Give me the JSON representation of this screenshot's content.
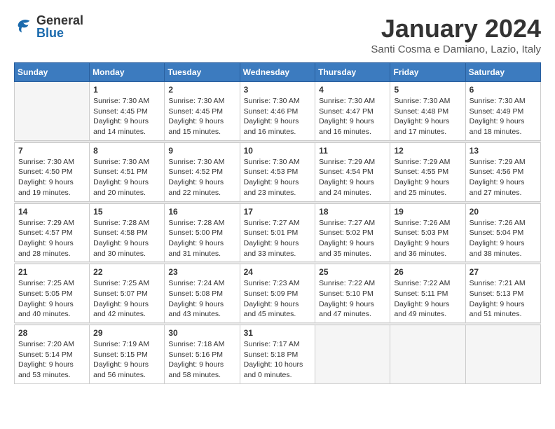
{
  "header": {
    "logo_general": "General",
    "logo_blue": "Blue",
    "month_title": "January 2024",
    "location": "Santi Cosma e Damiano, Lazio, Italy"
  },
  "calendar": {
    "days_of_week": [
      "Sunday",
      "Monday",
      "Tuesday",
      "Wednesday",
      "Thursday",
      "Friday",
      "Saturday"
    ],
    "weeks": [
      [
        {
          "num": "",
          "lines": []
        },
        {
          "num": "1",
          "lines": [
            "Sunrise: 7:30 AM",
            "Sunset: 4:45 PM",
            "Daylight: 9 hours",
            "and 14 minutes."
          ]
        },
        {
          "num": "2",
          "lines": [
            "Sunrise: 7:30 AM",
            "Sunset: 4:45 PM",
            "Daylight: 9 hours",
            "and 15 minutes."
          ]
        },
        {
          "num": "3",
          "lines": [
            "Sunrise: 7:30 AM",
            "Sunset: 4:46 PM",
            "Daylight: 9 hours",
            "and 16 minutes."
          ]
        },
        {
          "num": "4",
          "lines": [
            "Sunrise: 7:30 AM",
            "Sunset: 4:47 PM",
            "Daylight: 9 hours",
            "and 16 minutes."
          ]
        },
        {
          "num": "5",
          "lines": [
            "Sunrise: 7:30 AM",
            "Sunset: 4:48 PM",
            "Daylight: 9 hours",
            "and 17 minutes."
          ]
        },
        {
          "num": "6",
          "lines": [
            "Sunrise: 7:30 AM",
            "Sunset: 4:49 PM",
            "Daylight: 9 hours",
            "and 18 minutes."
          ]
        }
      ],
      [
        {
          "num": "7",
          "lines": [
            "Sunrise: 7:30 AM",
            "Sunset: 4:50 PM",
            "Daylight: 9 hours",
            "and 19 minutes."
          ]
        },
        {
          "num": "8",
          "lines": [
            "Sunrise: 7:30 AM",
            "Sunset: 4:51 PM",
            "Daylight: 9 hours",
            "and 20 minutes."
          ]
        },
        {
          "num": "9",
          "lines": [
            "Sunrise: 7:30 AM",
            "Sunset: 4:52 PM",
            "Daylight: 9 hours",
            "and 22 minutes."
          ]
        },
        {
          "num": "10",
          "lines": [
            "Sunrise: 7:30 AM",
            "Sunset: 4:53 PM",
            "Daylight: 9 hours",
            "and 23 minutes."
          ]
        },
        {
          "num": "11",
          "lines": [
            "Sunrise: 7:29 AM",
            "Sunset: 4:54 PM",
            "Daylight: 9 hours",
            "and 24 minutes."
          ]
        },
        {
          "num": "12",
          "lines": [
            "Sunrise: 7:29 AM",
            "Sunset: 4:55 PM",
            "Daylight: 9 hours",
            "and 25 minutes."
          ]
        },
        {
          "num": "13",
          "lines": [
            "Sunrise: 7:29 AM",
            "Sunset: 4:56 PM",
            "Daylight: 9 hours",
            "and 27 minutes."
          ]
        }
      ],
      [
        {
          "num": "14",
          "lines": [
            "Sunrise: 7:29 AM",
            "Sunset: 4:57 PM",
            "Daylight: 9 hours",
            "and 28 minutes."
          ]
        },
        {
          "num": "15",
          "lines": [
            "Sunrise: 7:28 AM",
            "Sunset: 4:58 PM",
            "Daylight: 9 hours",
            "and 30 minutes."
          ]
        },
        {
          "num": "16",
          "lines": [
            "Sunrise: 7:28 AM",
            "Sunset: 5:00 PM",
            "Daylight: 9 hours",
            "and 31 minutes."
          ]
        },
        {
          "num": "17",
          "lines": [
            "Sunrise: 7:27 AM",
            "Sunset: 5:01 PM",
            "Daylight: 9 hours",
            "and 33 minutes."
          ]
        },
        {
          "num": "18",
          "lines": [
            "Sunrise: 7:27 AM",
            "Sunset: 5:02 PM",
            "Daylight: 9 hours",
            "and 35 minutes."
          ]
        },
        {
          "num": "19",
          "lines": [
            "Sunrise: 7:26 AM",
            "Sunset: 5:03 PM",
            "Daylight: 9 hours",
            "and 36 minutes."
          ]
        },
        {
          "num": "20",
          "lines": [
            "Sunrise: 7:26 AM",
            "Sunset: 5:04 PM",
            "Daylight: 9 hours",
            "and 38 minutes."
          ]
        }
      ],
      [
        {
          "num": "21",
          "lines": [
            "Sunrise: 7:25 AM",
            "Sunset: 5:05 PM",
            "Daylight: 9 hours",
            "and 40 minutes."
          ]
        },
        {
          "num": "22",
          "lines": [
            "Sunrise: 7:25 AM",
            "Sunset: 5:07 PM",
            "Daylight: 9 hours",
            "and 42 minutes."
          ]
        },
        {
          "num": "23",
          "lines": [
            "Sunrise: 7:24 AM",
            "Sunset: 5:08 PM",
            "Daylight: 9 hours",
            "and 43 minutes."
          ]
        },
        {
          "num": "24",
          "lines": [
            "Sunrise: 7:23 AM",
            "Sunset: 5:09 PM",
            "Daylight: 9 hours",
            "and 45 minutes."
          ]
        },
        {
          "num": "25",
          "lines": [
            "Sunrise: 7:22 AM",
            "Sunset: 5:10 PM",
            "Daylight: 9 hours",
            "and 47 minutes."
          ]
        },
        {
          "num": "26",
          "lines": [
            "Sunrise: 7:22 AM",
            "Sunset: 5:11 PM",
            "Daylight: 9 hours",
            "and 49 minutes."
          ]
        },
        {
          "num": "27",
          "lines": [
            "Sunrise: 7:21 AM",
            "Sunset: 5:13 PM",
            "Daylight: 9 hours",
            "and 51 minutes."
          ]
        }
      ],
      [
        {
          "num": "28",
          "lines": [
            "Sunrise: 7:20 AM",
            "Sunset: 5:14 PM",
            "Daylight: 9 hours",
            "and 53 minutes."
          ]
        },
        {
          "num": "29",
          "lines": [
            "Sunrise: 7:19 AM",
            "Sunset: 5:15 PM",
            "Daylight: 9 hours",
            "and 56 minutes."
          ]
        },
        {
          "num": "30",
          "lines": [
            "Sunrise: 7:18 AM",
            "Sunset: 5:16 PM",
            "Daylight: 9 hours",
            "and 58 minutes."
          ]
        },
        {
          "num": "31",
          "lines": [
            "Sunrise: 7:17 AM",
            "Sunset: 5:18 PM",
            "Daylight: 10 hours",
            "and 0 minutes."
          ]
        },
        {
          "num": "",
          "lines": []
        },
        {
          "num": "",
          "lines": []
        },
        {
          "num": "",
          "lines": []
        }
      ]
    ]
  }
}
